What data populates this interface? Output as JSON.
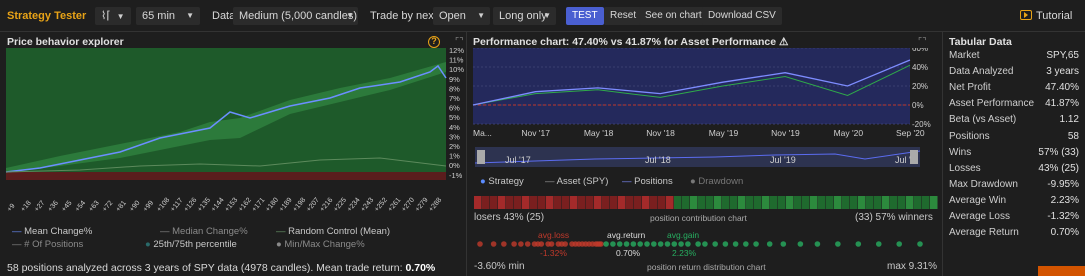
{
  "toolbar": {
    "title": "Strategy Tester",
    "chart_type_symbol": "⌇⌈",
    "interval": "65 min",
    "data_label": "Data",
    "data_value": "Medium (5,000 candles)",
    "trade_by_label": "Trade by next",
    "trade_by_value": "Open",
    "direction_value": "Long only",
    "test_label": "TEST",
    "reset_label": "Reset",
    "see_on_chart_label": "See on chart",
    "download_label": "Download CSV",
    "tutorial_label": "Tutorial"
  },
  "price_behavior": {
    "title": "Price behavior explorer",
    "help": "?",
    "y_ticks": [
      "12%",
      "11%",
      "10%",
      "9%",
      "8%",
      "7%",
      "6%",
      "5%",
      "4%",
      "3%",
      "2%",
      "1%",
      "0%",
      "-1%"
    ],
    "x_ticks": [
      "+9",
      "+18",
      "+27",
      "+36",
      "+45",
      "+54",
      "+63",
      "+72",
      "+81",
      "+90",
      "+99",
      "+108",
      "+117",
      "+126",
      "+135",
      "+144",
      "+153",
      "+162",
      "+171",
      "+180",
      "+189",
      "+198",
      "+207",
      "+216",
      "+225",
      "+234",
      "+243",
      "+252",
      "+261",
      "+270",
      "+279",
      "+288"
    ],
    "legend": {
      "mean": "Mean Change%",
      "median": "Median Change%",
      "random": "Random Control (Mean)",
      "positions": "# Of Positions",
      "percentile": "25th/75th percentile",
      "minmax": "Min/Max Change%"
    },
    "footer_text": "58 positions analyzed across 3 years of SPY data (4978 candles). Mean trade return:",
    "footer_value": "0.70%",
    "colors": {
      "band": "#1e5a2a",
      "mean": "#6b8fff",
      "zone": "#5a1d1d"
    }
  },
  "chart_data": {
    "type": "line",
    "title": "Performance chart: 47.40% vs 41.87% for Asset Performance",
    "x": [
      "Mar '17",
      "Nov '17",
      "May '18",
      "Nov '18",
      "May '19",
      "Nov '19",
      "May '20",
      "Sep '20"
    ],
    "series": [
      {
        "name": "Strategy",
        "values": [
          0,
          14,
          18,
          12,
          24,
          34,
          20,
          47.4
        ]
      },
      {
        "name": "Asset (SPY)",
        "values": [
          0,
          12,
          16,
          8,
          20,
          30,
          10,
          41.87
        ]
      }
    ],
    "y_ticks": [
      "60%",
      "40%",
      "20%",
      "0%",
      "-20%"
    ],
    "ylim": [
      -20,
      60
    ],
    "grid": true,
    "legend_position": "bottom"
  },
  "performance": {
    "title": "Performance chart: 47.40% vs 41.87% for Asset Performance",
    "warn_icon": "⚠",
    "x_ticks": [
      "Ma...",
      "Nov '17",
      "May '18",
      "Nov '18",
      "May '19",
      "Nov '19",
      "May '20",
      "Sep '20"
    ],
    "y_ticks": [
      "60%",
      "40%",
      "20%",
      "0%",
      "-20%"
    ],
    "nav_ticks": [
      "Jul '17",
      "Jul '18",
      "Jul '19",
      "Jul '"
    ],
    "legend": {
      "strategy": "Strategy",
      "asset": "Asset (SPY)",
      "positions": "Positions",
      "drawdown": "Drawdown"
    },
    "contribution": {
      "left_label": "losers 43% (25)",
      "center_label": "position contribution chart",
      "right_label": "(33) 57% winners"
    },
    "distribution": {
      "avg_loss_label": "avg.loss",
      "avg_loss_value": "-1.32%",
      "avg_return_label": "avg.return",
      "avg_return_value": "0.70%",
      "avg_gain_label": "avg.gain",
      "avg_gain_value": "2.23%",
      "min_label": "-3.60% min",
      "center_label": "position return distribution chart",
      "max_label": "max 9.31%"
    },
    "colors": {
      "strategy": "#5b6cf0",
      "asset": "#2faa4a",
      "loss": "#c0392b",
      "gain": "#27ae60",
      "fill": "#2a2f6e"
    }
  },
  "tabular": {
    "title": "Tabular Data",
    "rows": [
      {
        "key": "Market",
        "value": "SPY,65"
      },
      {
        "key": "Data Analyzed",
        "value": "3 years"
      },
      {
        "key": "Net Profit",
        "value": "47.40%"
      },
      {
        "key": "Asset Performance",
        "value": "41.87%"
      },
      {
        "key": "Beta (vs Asset)",
        "value": "1.12"
      },
      {
        "key": "Positions",
        "value": "58"
      },
      {
        "key": "Wins",
        "value": "57% (33)"
      },
      {
        "key": "Losses",
        "value": "43% (25)"
      },
      {
        "key": "Max Drawdown",
        "value": "-9.95%"
      },
      {
        "key": "Average Win",
        "value": "2.23%"
      },
      {
        "key": "Average Loss",
        "value": "-1.32%"
      },
      {
        "key": "Average Return",
        "value": "0.70%"
      }
    ]
  }
}
